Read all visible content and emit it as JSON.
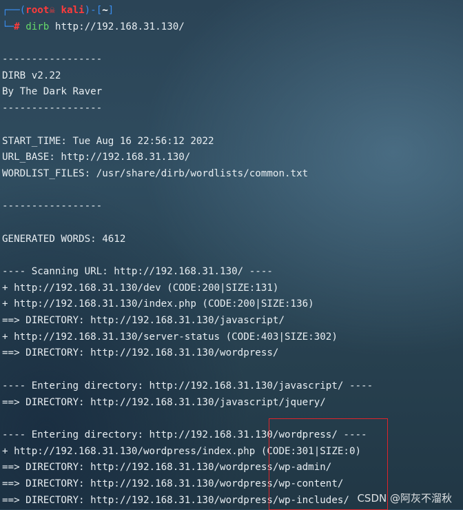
{
  "prompt": {
    "line1_prefix": "┌──(",
    "user": "root",
    "host_sep": "☠ ",
    "host": "kali",
    "line1_mid": ")-[",
    "cwd": "~",
    "line1_end": "]",
    "line2_prefix": "└─",
    "hash": "#",
    "command": "dirb",
    "argument": " http://192.168.31.130/"
  },
  "output": {
    "sep1": "-----------------",
    "version": "DIRB v2.22",
    "author": "By The Dark Raver",
    "sep2": "-----------------",
    "start_time": "START_TIME: Tue Aug 16 22:56:12 2022",
    "url_base": "URL_BASE: http://192.168.31.130/",
    "wordlist": "WORDLIST_FILES: /usr/share/dirb/wordlists/common.txt",
    "sep3": "-----------------",
    "generated": "GENERATED WORDS: 4612",
    "scan_header": "---- Scanning URL: http://192.168.31.130/ ----",
    "results1": [
      "+ http://192.168.31.130/dev (CODE:200|SIZE:131)",
      "+ http://192.168.31.130/index.php (CODE:200|SIZE:136)",
      "==> DIRECTORY: http://192.168.31.130/javascript/",
      "+ http://192.168.31.130/server-status (CODE:403|SIZE:302)",
      "==> DIRECTORY: http://192.168.31.130/wordpress/"
    ],
    "enter_js": "---- Entering directory: http://192.168.31.130/javascript/ ----",
    "results2": [
      "==> DIRECTORY: http://192.168.31.130/javascript/jquery/"
    ],
    "enter_wp": "---- Entering directory: http://192.168.31.130/wordpress/ ----",
    "results3": [
      "+ http://192.168.31.130/wordpress/index.php (CODE:301|SIZE:0)",
      "==> DIRECTORY: http://192.168.31.130/wordpress/wp-admin/",
      "==> DIRECTORY: http://192.168.31.130/wordpress/wp-content/",
      "==> DIRECTORY: http://192.168.31.130/wordpress/wp-includes/"
    ]
  },
  "watermark": "CSDN @阿灰不溜秋",
  "colors": {
    "prompt_frame": "#3a8ef0",
    "user_host": "#ff3b3b",
    "command": "#66d96a",
    "highlight_box": "#e0242a"
  }
}
